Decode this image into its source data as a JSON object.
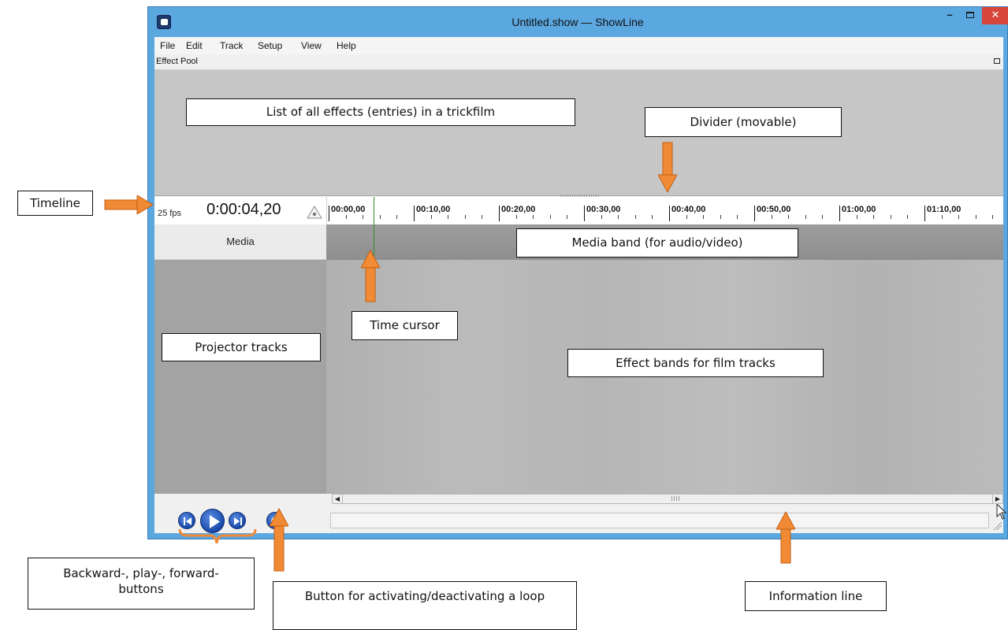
{
  "window": {
    "title": "Untitled.show — ShowLine",
    "min_glyph": "–",
    "close_glyph": "✕"
  },
  "menu": [
    "File",
    "Edit",
    "Track",
    "Setup",
    "View",
    "Help"
  ],
  "effect_pool": {
    "title": "Effect Pool"
  },
  "timeline": {
    "fps": "25 fps",
    "timecode": "0:00:04,20",
    "ticks": [
      "00:00,00",
      "00:10,00",
      "00:20,00",
      "00:30,00",
      "00:40,00",
      "00:50,00",
      "01:00,00",
      "01:10,00"
    ]
  },
  "tracks": {
    "media_label": "Media"
  },
  "scrollbar": {
    "left_glyph": "◀",
    "right_glyph": "▶"
  },
  "annotations": {
    "effects_list": "List of all effects (entries) in a trickfilm",
    "divider": "Divider (movable)",
    "timeline": "Timeline",
    "media_band": "Media band (for audio/video)",
    "time_cursor": "Time cursor",
    "projector_tracks": "Projector tracks",
    "effect_bands": "Effect bands for film tracks",
    "transport_buttons": "Backward-, play-, forward-buttons",
    "loop_button": "Button for activating/deactivating a loop",
    "information_line": "Information line"
  },
  "colors": {
    "titlebar": "#5ba7e0",
    "close_button": "#d6463a",
    "annotation_arrow": "#f08a35",
    "transport_button": "#1849a8",
    "time_cursor": "#2e8b2e"
  }
}
